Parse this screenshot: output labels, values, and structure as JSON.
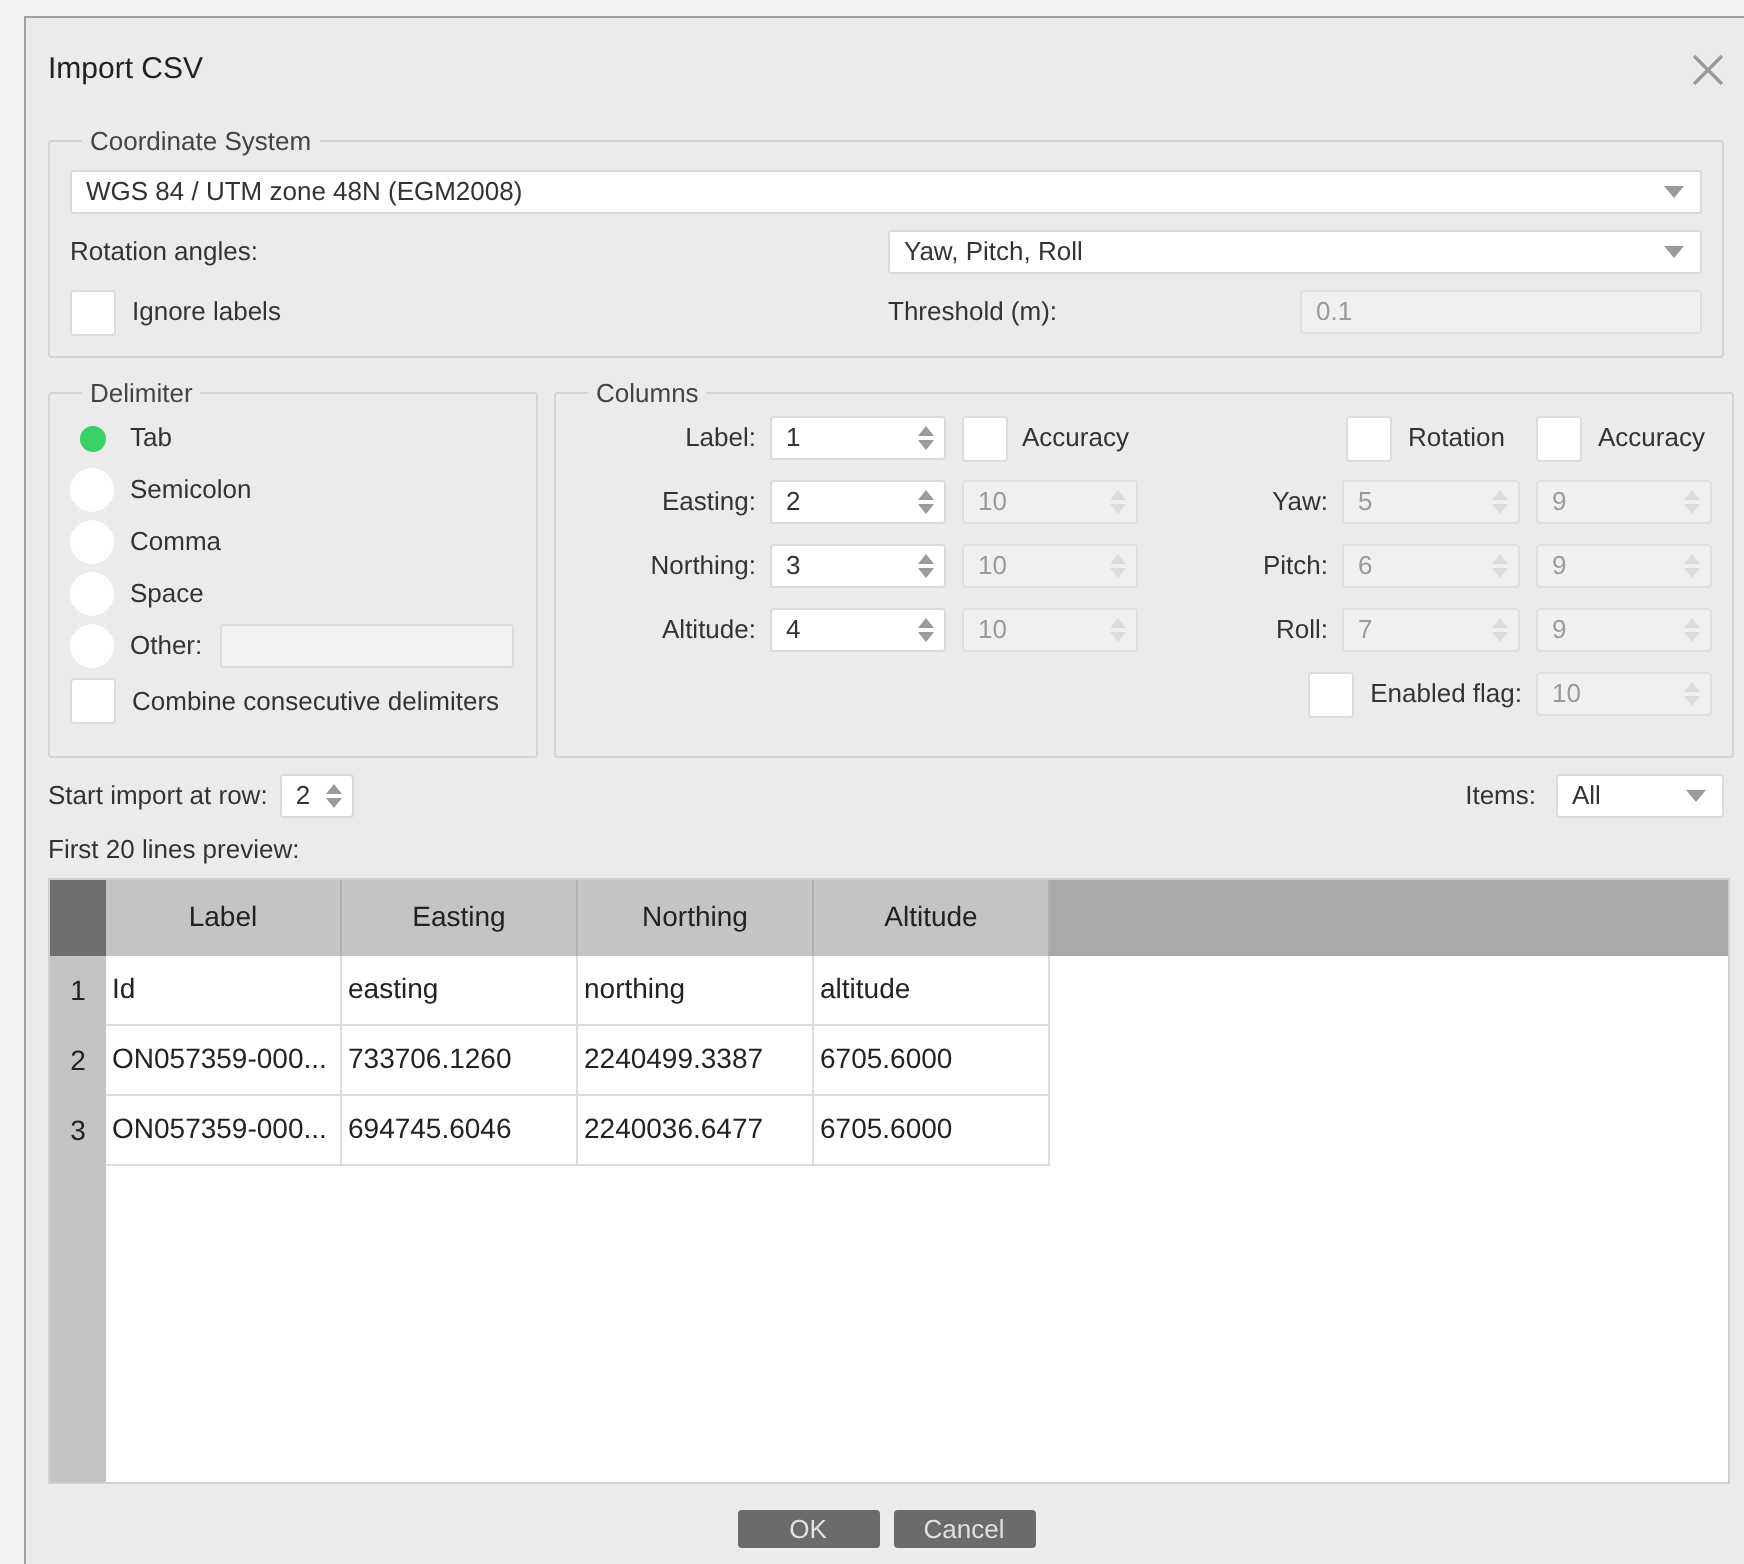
{
  "window": {
    "title": "Import CSV"
  },
  "coordinate_system": {
    "legend": "Coordinate System",
    "value": "WGS 84 / UTM zone 48N (EGM2008)"
  },
  "rotation_angles": {
    "label": "Rotation angles:",
    "value": "Yaw, Pitch, Roll"
  },
  "ignore_labels": {
    "label": "Ignore labels",
    "checked": false
  },
  "threshold": {
    "label": "Threshold (m):",
    "value": "0.1",
    "disabled": true
  },
  "delimiter": {
    "legend": "Delimiter",
    "options": [
      {
        "label": "Tab",
        "selected": true
      },
      {
        "label": "Semicolon",
        "selected": false
      },
      {
        "label": "Comma",
        "selected": false
      },
      {
        "label": "Space",
        "selected": false
      },
      {
        "label": "Other:",
        "selected": false,
        "kind": "other"
      }
    ],
    "combine": {
      "label": "Combine consecutive delimiters",
      "checked": false
    }
  },
  "columns": {
    "legend": "Columns",
    "position_accuracy": {
      "label": "Accuracy",
      "checked": false
    },
    "position": [
      {
        "label": "Label:",
        "value": "1"
      },
      {
        "label": "Easting:",
        "value": "2",
        "accuracy": "10"
      },
      {
        "label": "Northing:",
        "value": "3",
        "accuracy": "10"
      },
      {
        "label": "Altitude:",
        "value": "4",
        "accuracy": "10"
      }
    ],
    "rotation": {
      "label": "Rotation",
      "checked": false
    },
    "rotation_accuracy": {
      "label": "Accuracy",
      "checked": false
    },
    "angles": [
      {
        "label": "Yaw:",
        "value": "5",
        "accuracy": "9"
      },
      {
        "label": "Pitch:",
        "value": "6",
        "accuracy": "9"
      },
      {
        "label": "Roll:",
        "value": "7",
        "accuracy": "9"
      }
    ],
    "enabled_flag": {
      "label": "Enabled flag:",
      "checked": false,
      "value": "10"
    }
  },
  "start_row": {
    "label": "Start import at row:",
    "value": "2"
  },
  "items": {
    "label": "Items:",
    "value": "All"
  },
  "preview_label": "First 20 lines preview:",
  "table": {
    "columns": [
      "Label",
      "Easting",
      "Northing",
      "Altitude"
    ],
    "rows": [
      {
        "number": "1",
        "cells": [
          "Id",
          "easting",
          "northing",
          "altitude"
        ]
      },
      {
        "number": "2",
        "cells": [
          "ON057359-000...",
          "733706.1260",
          "2240499.3387",
          "6705.6000"
        ]
      },
      {
        "number": "3",
        "cells": [
          "ON057359-000...",
          "694745.6046",
          "2240036.6477",
          "6705.6000"
        ]
      }
    ]
  },
  "buttons": [
    "OK",
    "Cancel"
  ]
}
